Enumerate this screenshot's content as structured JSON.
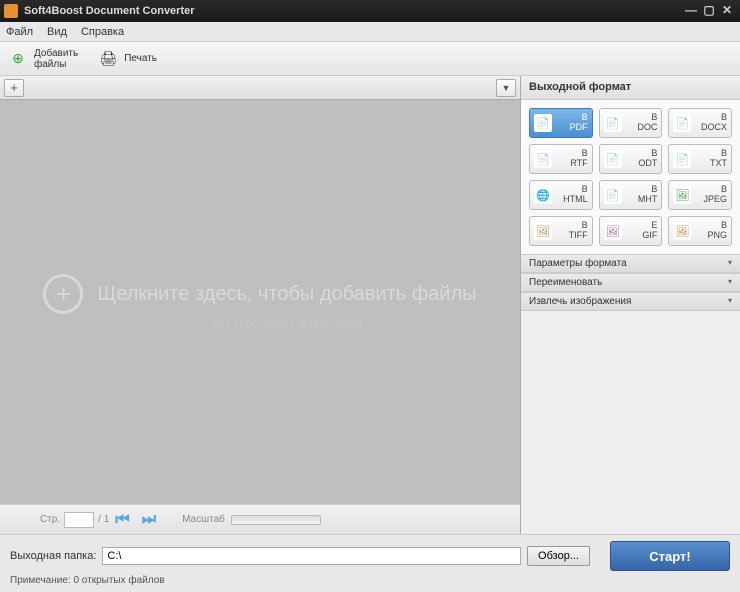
{
  "titlebar": {
    "title": "Soft4Boost Document Converter"
  },
  "menubar": {
    "file": "Файл",
    "view": "Вид",
    "help": "Справка"
  },
  "toolbar": {
    "add_files_line1": "Добавить",
    "add_files_line2": "файлы",
    "print": "Печать"
  },
  "tabs": {
    "add": "+",
    "dropdown": "▼"
  },
  "drop": {
    "main": "Щелкните здесь, чтобы добавить файлы",
    "sub": "или перетащите файлы сюда"
  },
  "pager": {
    "label": "Стр.",
    "page_value": "",
    "total": "/ 1",
    "zoom_label": "Масштаб"
  },
  "right": {
    "header": "Выходной формат",
    "prefix": "В",
    "formats": [
      {
        "id": "pdf",
        "label": "PDF",
        "selected": true,
        "icon": "📄"
      },
      {
        "id": "doc",
        "label": "DOC",
        "icon": "📄"
      },
      {
        "id": "docx",
        "label": "DOCX",
        "icon": "📄"
      },
      {
        "id": "rtf",
        "label": "RTF",
        "icon": "📄"
      },
      {
        "id": "odt",
        "label": "ODT",
        "icon": "📄"
      },
      {
        "id": "txt",
        "label": "TXT",
        "icon": "📄"
      },
      {
        "id": "html",
        "label": "HTML",
        "icon": "🌐"
      },
      {
        "id": "mht",
        "label": "MHT",
        "icon": "📄"
      },
      {
        "id": "jpeg",
        "label": "JPEG",
        "icon": "🖼"
      },
      {
        "id": "tiff",
        "label": "TIFF",
        "icon": "🖼"
      },
      {
        "id": "gif",
        "label": "GIF",
        "prefix_override": "E",
        "icon": "🖼"
      },
      {
        "id": "png",
        "label": "PNG",
        "icon": "🖼"
      }
    ],
    "accordion": [
      "Параметры формата",
      "Переименовать",
      "Извлечь изображения"
    ]
  },
  "footer": {
    "outdir_label": "Выходная папка:",
    "outdir_value": "C:\\",
    "browse": "Обзор...",
    "start": "Старт!",
    "note": "Примечание: 0 открытых файлов"
  }
}
